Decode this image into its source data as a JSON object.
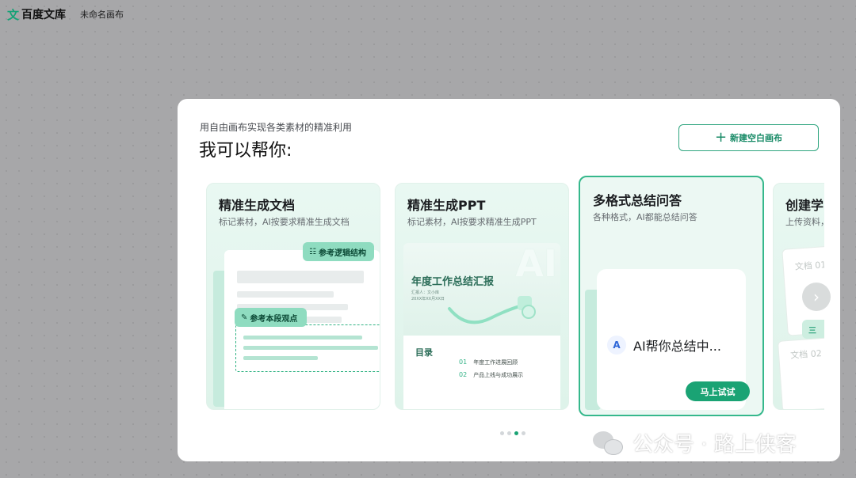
{
  "app": {
    "logo_mark": "文",
    "name": "百度文库",
    "canvas_name": "未命名画布"
  },
  "modal": {
    "subtitle": "用自由画布实现各类素材的精准利用",
    "headline": "我可以帮你:",
    "new_button": {
      "icon": "plus-icon",
      "label": "新建空白画布"
    }
  },
  "cards": [
    {
      "title": "精准生成文档",
      "desc": "标记素材，AI按要求精准生成文档",
      "chips": [
        "参考逻辑结构",
        "参考本段观点"
      ]
    },
    {
      "title": "精准生成PPT",
      "desc": "标记素材，AI按要求精准生成PPT",
      "ppt": {
        "heading": "年度工作总结汇报",
        "small1": "汇报人：文小库",
        "small2": "20XX年XX月XX日",
        "toc": "目录",
        "rows": [
          {
            "num": "01",
            "text": "年度工作进展回顾"
          },
          {
            "num": "02",
            "text": "产品上线与成功展示"
          }
        ],
        "watermark": "AI"
      }
    },
    {
      "title": "多格式总结问答",
      "desc": "各种格式，AI都能总结问答",
      "ai_logo": "A",
      "ai_text": "AI帮你总结中...",
      "button": "马上试试"
    },
    {
      "title": "创建学习",
      "desc": "上传资料，",
      "docs": [
        "文档 01",
        "文档 02"
      ],
      "chip": "三"
    }
  ],
  "pagination": {
    "count": 4,
    "active_index": 2
  },
  "watermark": {
    "text": "公众号 · 路上侠客"
  },
  "colors": {
    "accent": "#1aa374",
    "card_bg": "#e9f8f2",
    "chip": "#8fdcc0"
  }
}
